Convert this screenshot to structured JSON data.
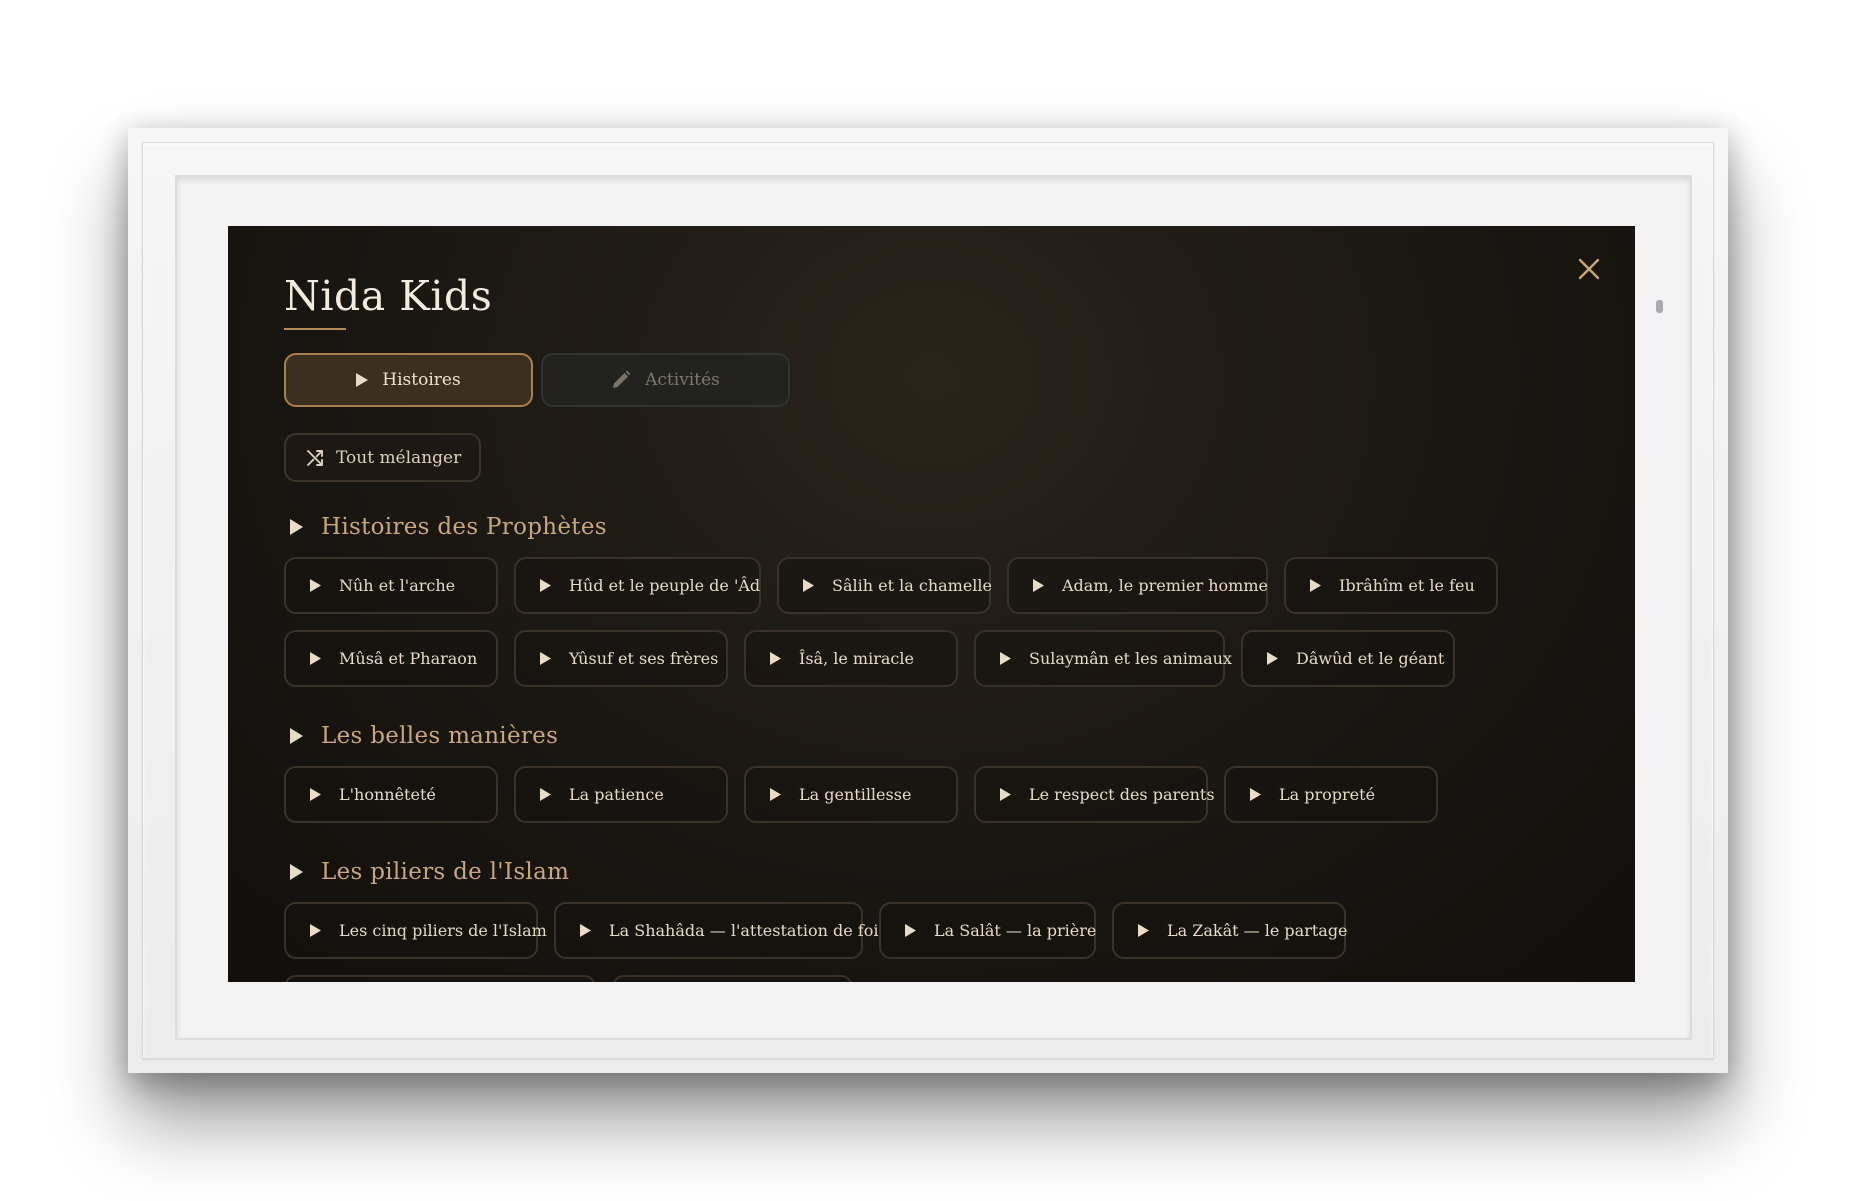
{
  "app": {
    "title": "Nida Kids"
  },
  "tabs": [
    {
      "label": "Histoires",
      "icon": "play-icon",
      "active": true
    },
    {
      "label": "Activités",
      "icon": "pencil-icon",
      "active": false
    }
  ],
  "shuffle": {
    "label": "Tout mélanger",
    "icon": "shuffle-icon"
  },
  "sections": [
    {
      "title": "Histoires des Prophètes",
      "items": [
        "Nûh et l'arche",
        "Hûd et le peuple de 'Âd",
        "Sâlih et la chamelle",
        "Adam, le premier homme",
        "Ibrâhîm et le feu",
        "Mûsâ et Pharaon",
        "Yûsuf et ses frères",
        "Îsâ, le miracle",
        "Sulaymân et les animaux",
        "Dâwûd et le géant"
      ]
    },
    {
      "title": "Les belles manières",
      "items": [
        "L'honnêteté",
        "La patience",
        "La gentillesse",
        "Le respect des parents",
        "La propreté"
      ]
    },
    {
      "title": "Les piliers de l'Islam",
      "items": [
        "Les cinq piliers de l'Islam",
        "La Shahâda — l'attestation de foi",
        "La Salât — la prière",
        "La Zakât — le partage"
      ]
    }
  ],
  "colors": {
    "accent": "#b48b58",
    "background": "#1a1612",
    "text": "#e6dac7",
    "chip_border": "#3a3128"
  }
}
